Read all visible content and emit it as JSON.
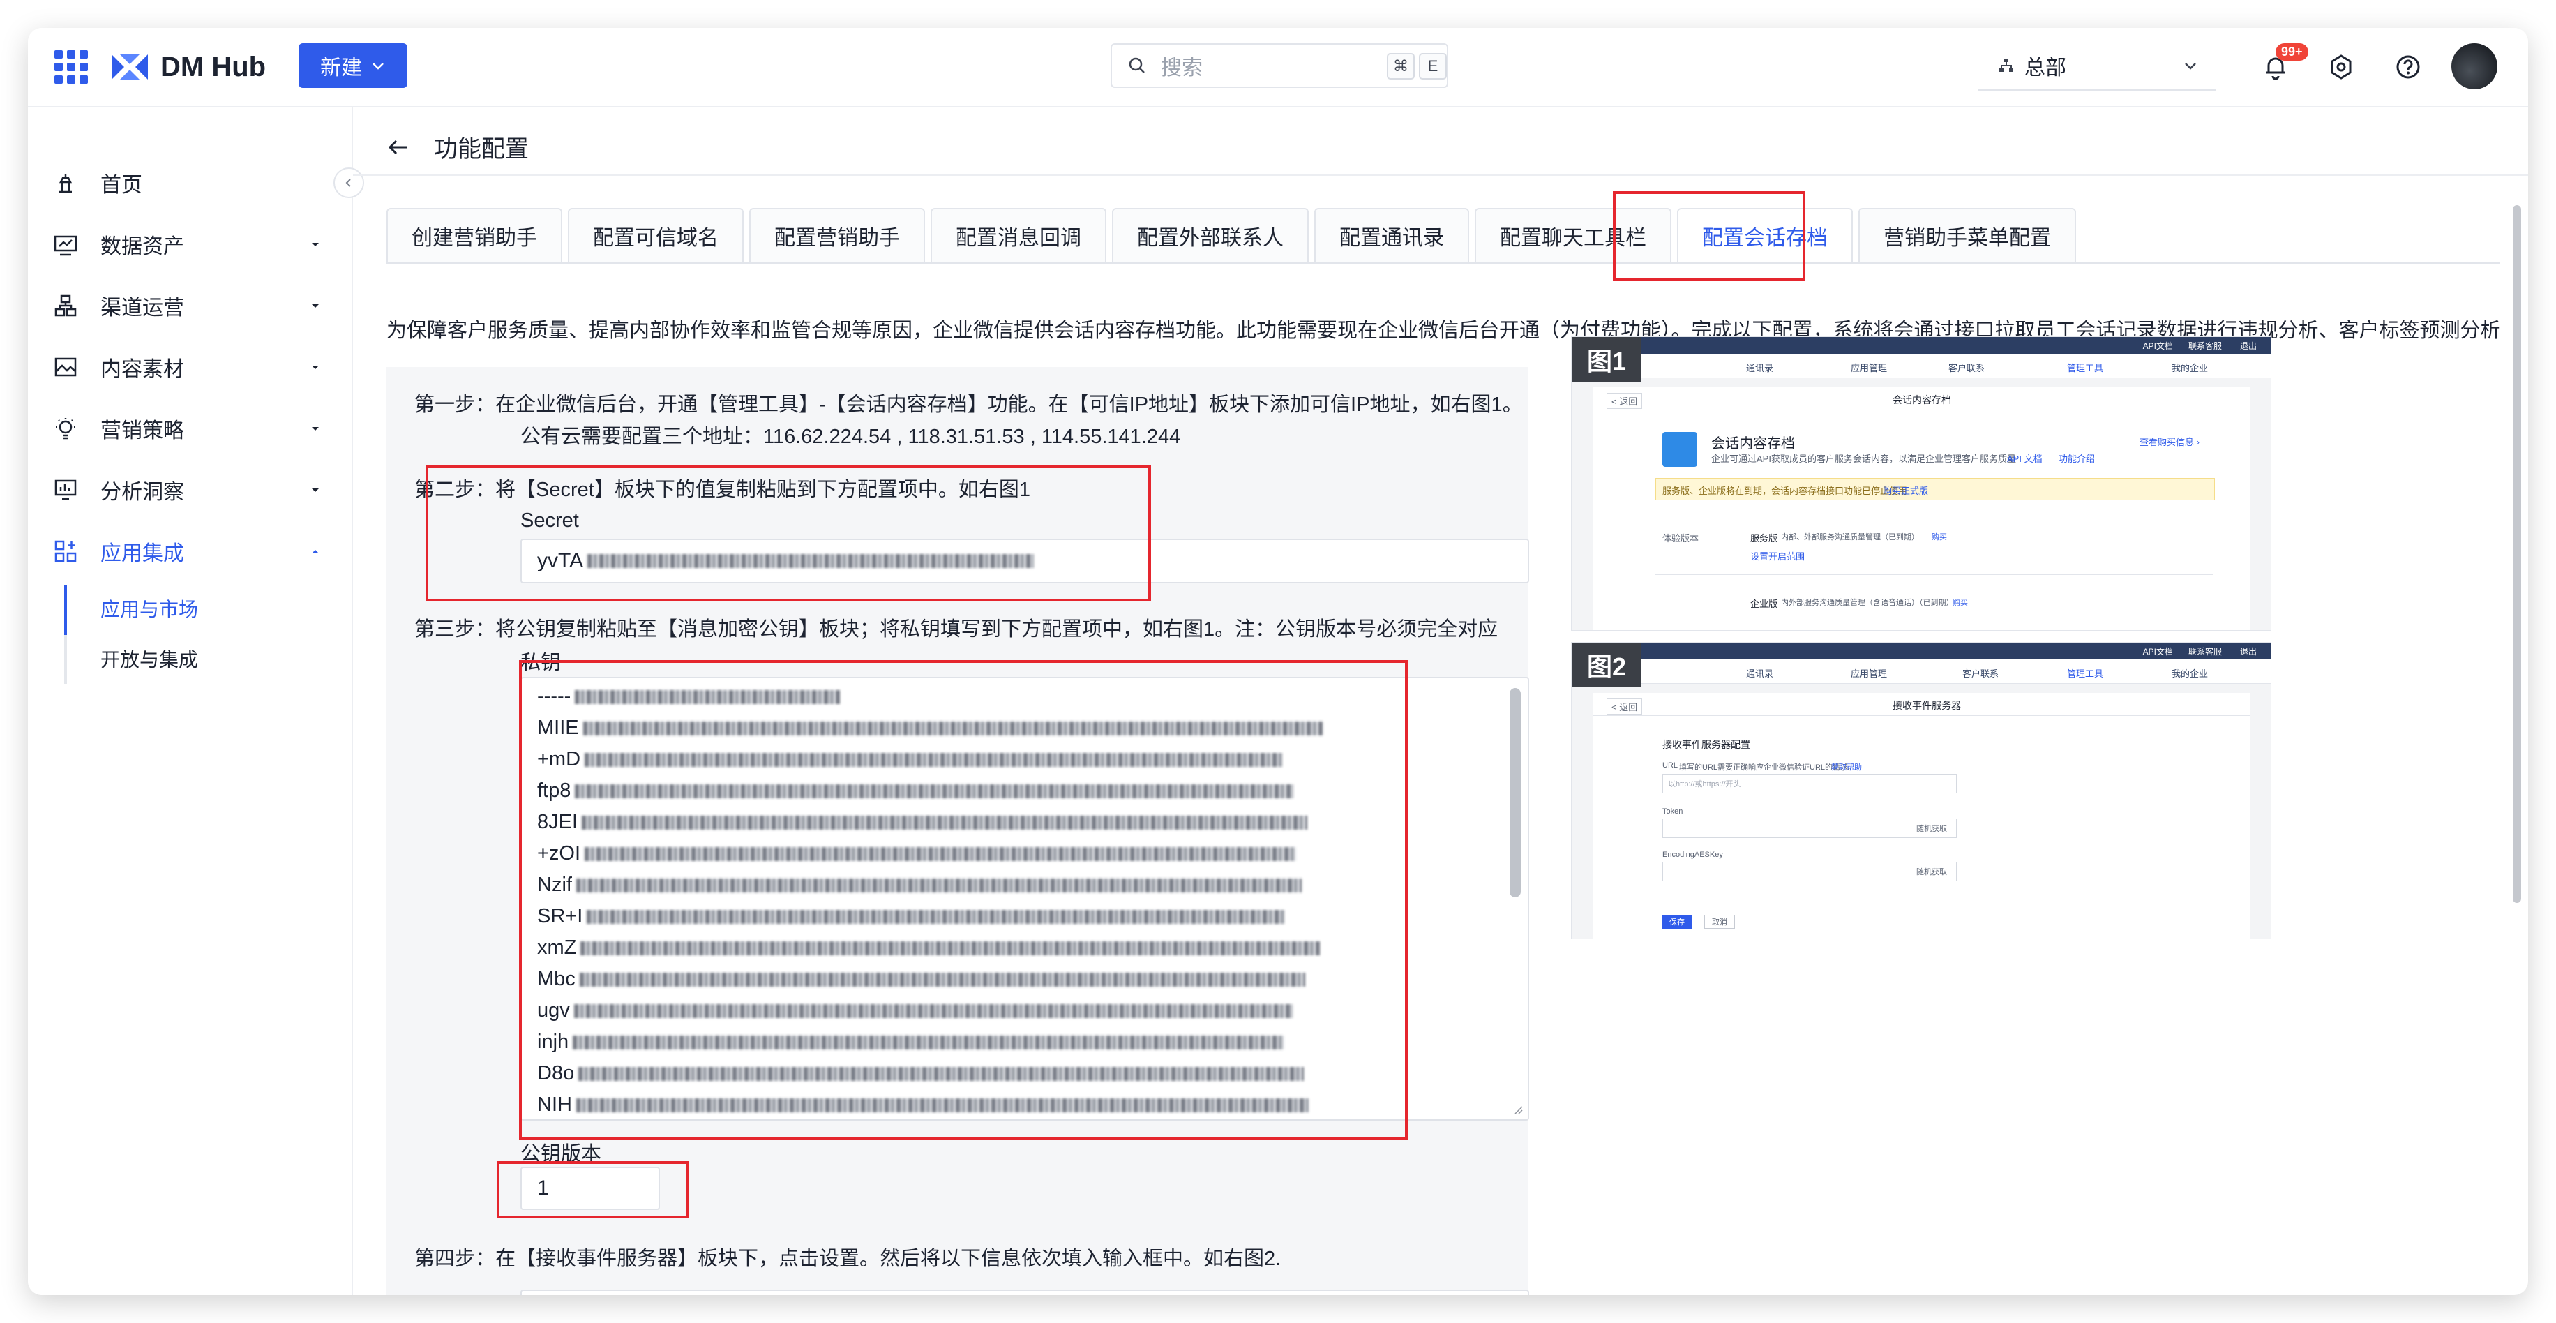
{
  "header": {
    "app_name": "DM Hub",
    "new_button": "新建",
    "search_placeholder": "搜索",
    "shortcut_key1": "⌘",
    "shortcut_key2": "E",
    "org_name": "总部",
    "notification_badge": "99+"
  },
  "sidebar": {
    "items": [
      {
        "label": "首页",
        "icon": "home-icon"
      },
      {
        "label": "数据资产",
        "icon": "data-asset-icon"
      },
      {
        "label": "渠道运营",
        "icon": "channel-icon"
      },
      {
        "label": "内容素材",
        "icon": "content-icon"
      },
      {
        "label": "营销策略",
        "icon": "strategy-icon"
      },
      {
        "label": "分析洞察",
        "icon": "analytics-icon"
      },
      {
        "label": "应用集成",
        "icon": "apps-icon"
      }
    ],
    "sub_items": [
      {
        "label": "应用与市场",
        "active": true
      },
      {
        "label": "开放与集成",
        "active": false
      }
    ]
  },
  "page": {
    "title": "功能配置",
    "tabs": [
      "创建营销助手",
      "配置可信域名",
      "配置营销助手",
      "配置消息回调",
      "配置外部联系人",
      "配置通讯录",
      "配置聊天工具栏",
      "配置会话存档",
      "营销助手菜单配置"
    ],
    "active_tab": "配置会话存档",
    "description": "为保障客户服务质量、提高内部协作效率和监管合规等原因，企业微信提供会话内容存档功能。此功能需要现在企业微信后台开通（为付费功能）。完成以下配置，系统将会通过接口拉取员工会话记录数据进行违规分析、客户标签预测分析"
  },
  "steps": {
    "step1_line1": "第一步：在企业微信后台，开通【管理工具】-【会话内容存档】功能。在【可信IP地址】板块下添加可信IP地址，如右图1。",
    "step1_line2": "公有云需要配置三个地址：116.62.224.54 , 118.31.51.53 , 114.55.141.244",
    "step2": "第二步：将【Secret】板块下的值复制粘贴到下方配置项中。如右图1",
    "secret_label": "Secret",
    "secret_value": "yvTA",
    "step3_line1": "第三步：将公钥复制粘贴至【消息加密公钥】板块；将私钥填写到下方配置项中，如右图1。注：公钥版本号必须完全对应",
    "private_key_label": "私钥",
    "private_key_lines": [
      "-----",
      "MIIE",
      "+mD",
      "ftp8",
      "8JEI",
      "+zOI",
      "Nzif",
      "SR+I",
      "xmZ",
      "Mbc",
      "ugv",
      "injh",
      "D8o",
      "NIH"
    ],
    "key_version_label": "公钥版本",
    "key_version_value": "1",
    "step4": "第四步：在【接收事件服务器】板块下，点击设置。然后将以下信息依次填入输入框中。如右图2."
  },
  "figures": {
    "fig1": {
      "label": "图1",
      "top_links": [
        "API文档",
        "联系客服",
        "退出"
      ],
      "nav": [
        "通讯录",
        "应用管理",
        "客户联系",
        "管理工具",
        "我的企业"
      ],
      "back": "< 返回",
      "page_title": "会话内容存档",
      "app_title": "会话内容存档",
      "app_desc": "企业可通过API获取成员的客户服务会话内容，以满足企业管理客户服务质量",
      "app_links": [
        "API 文档",
        "功能介绍"
      ],
      "buy_link": "查看购买信息 ›",
      "notice": "服务版、企业版将在到期，会话内容存档接口功能已停止使用",
      "notice_link": "购买正式版",
      "row_label": "体验版本",
      "row_item1": "服务版",
      "row_item1_desc": "内部、外部服务沟通质量管理（已到期）",
      "row_item1_link": "购买",
      "row_item1_sub": "设置开启范围",
      "row_item2": "企业版",
      "row_item2_desc": "内外部服务沟通质量管理（含语音通话）（已到期）",
      "row_item2_link": "购买"
    },
    "fig2": {
      "label": "图2",
      "top_links": [
        "API文档",
        "联系客服",
        "退出"
      ],
      "nav": [
        "通讯录",
        "应用管理",
        "客户联系",
        "管理工具",
        "我的企业"
      ],
      "back": "< 返回",
      "page_title": "接收事件服务器",
      "section": "接收事件服务器配置",
      "url_label": "URL",
      "url_hint": "填写的URL需要正确响应企业微信验证URL的请求。",
      "url_hint_link": "获取帮助",
      "url_placeholder": "以http://或https://开头",
      "token_label": "Token",
      "aes_label": "EncodingAESKey",
      "random_btn": "随机获取",
      "save": "保存",
      "cancel": "取消"
    }
  },
  "colors": {
    "brand": "#2f5bea",
    "highlight_box": "#e5262e",
    "panel_bg": "#f5f6f8"
  }
}
